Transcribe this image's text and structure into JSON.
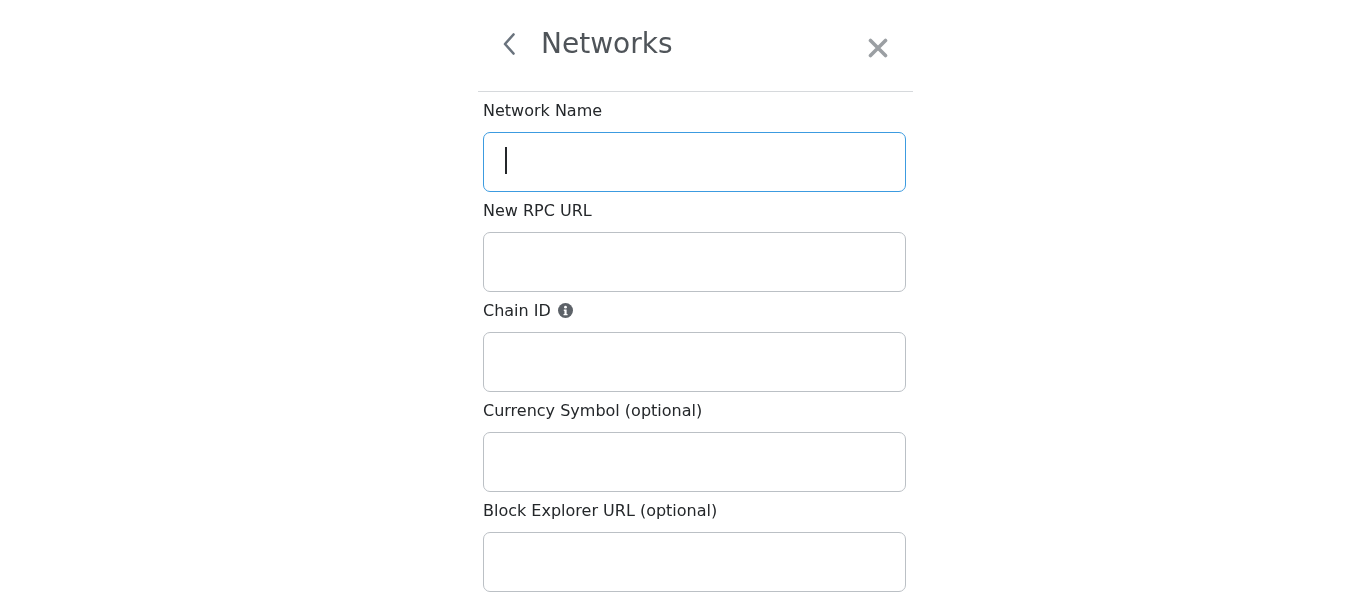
{
  "header": {
    "title": "Networks"
  },
  "fields": [
    {
      "label": "Network Name",
      "info": false,
      "focused": true
    },
    {
      "label": "New RPC URL",
      "info": false,
      "focused": false
    },
    {
      "label": "Chain ID",
      "info": true,
      "focused": false
    },
    {
      "label": "Currency Symbol (optional)",
      "info": false,
      "focused": false
    },
    {
      "label": "Block Explorer URL (optional)",
      "info": false,
      "focused": false
    }
  ]
}
